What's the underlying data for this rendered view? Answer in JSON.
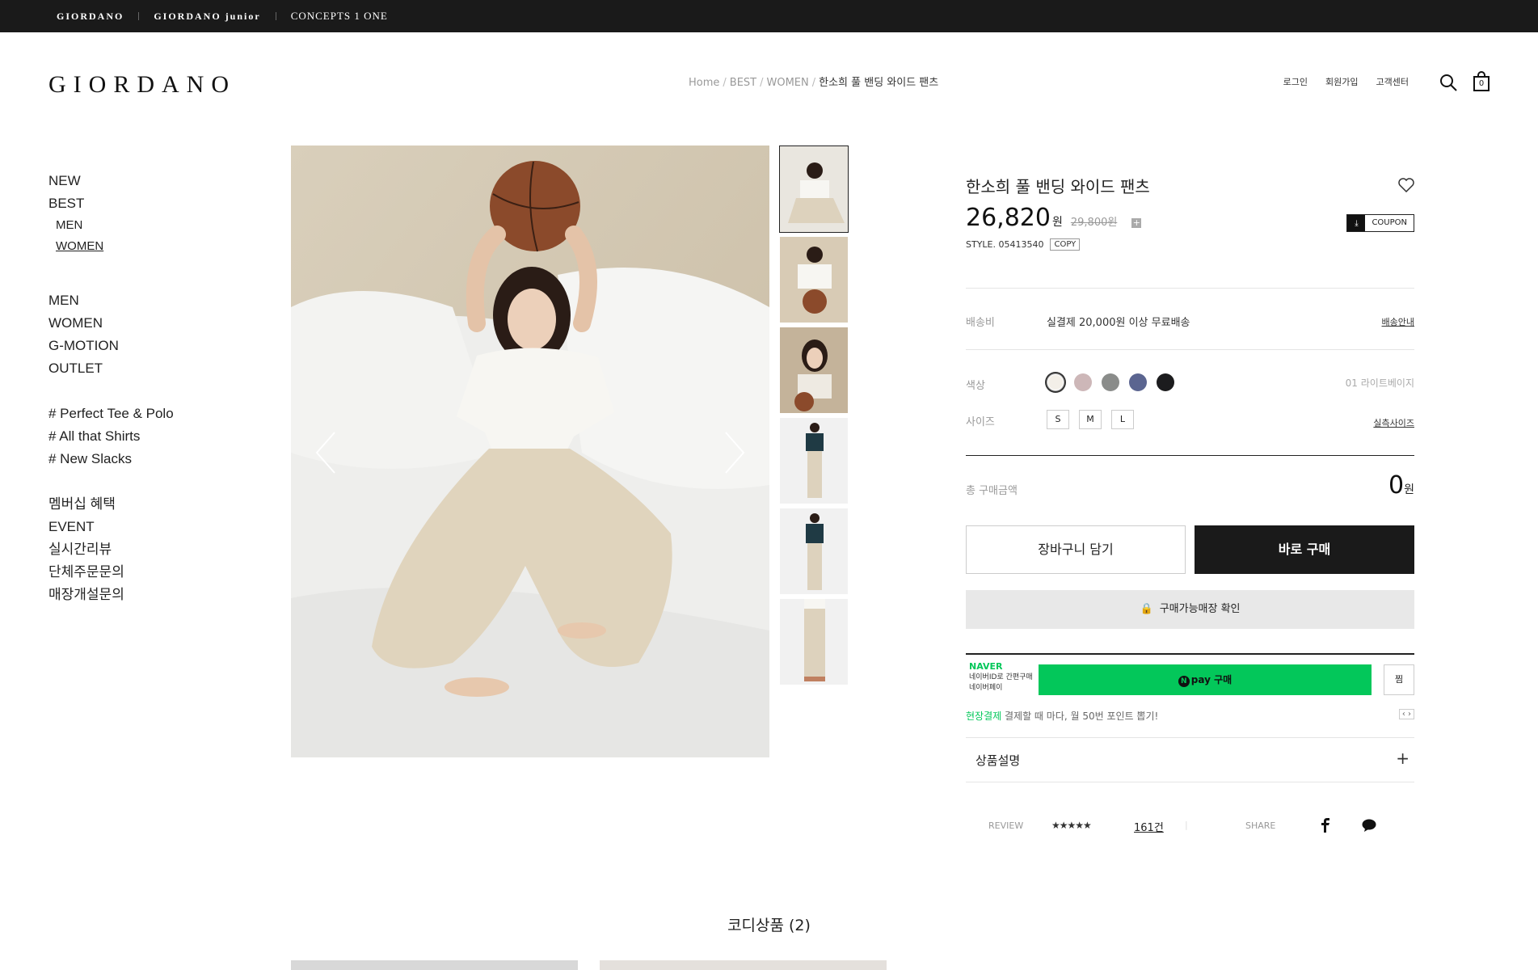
{
  "brandbar": {
    "brands": [
      "GIORDANO",
      "GIORDANO junior",
      "CONCEPTS 1 ONE"
    ]
  },
  "header": {
    "logo": "GIORDANO",
    "breadcrumb": [
      "Home",
      "BEST",
      "WOMEN",
      "한소희 풀 밴딩 와이드 팬츠"
    ],
    "util_links": [
      "로그인",
      "회원가입",
      "고객센터"
    ],
    "cart_count": "0"
  },
  "leftnav": {
    "group1": [
      "NEW",
      "BEST"
    ],
    "best_sub": [
      "MEN",
      "WOMEN"
    ],
    "group2": [
      "MEN",
      "WOMEN",
      "G-MOTION",
      "OUTLET"
    ],
    "hashtags": [
      "# Perfect Tee & Polo",
      "# All that Shirts",
      "# New Slacks"
    ],
    "group3": [
      "멤버십 혜택",
      "EVENT",
      "실시간리뷰",
      "단체주문문의",
      "매장개설문의"
    ]
  },
  "product": {
    "title": "한소희 풀 밴딩 와이드 팬츠",
    "price": "26,820",
    "price_unit": "원",
    "original_price": "29,800원",
    "coupon_label": "COUPON",
    "style_label": "STYLE. 05413540",
    "copy_label": "COPY",
    "shipping_label": "배송비",
    "shipping_value": "실결제 20,000원 이상 무료배송",
    "shipping_link": "배송안내",
    "color_label": "색상",
    "color_selected": "01 라이트베이지",
    "colors": [
      "#f3efe8",
      "#cdb7b8",
      "#8a8c8a",
      "#5b6590",
      "#1c1c1e"
    ],
    "size_label": "사이즈",
    "sizes": [
      "S",
      "M",
      "L"
    ],
    "size_link": "실측사이즈",
    "total_label": "총 구매금액",
    "total_value": "0",
    "total_unit": "원",
    "cart_button": "장바구니 담기",
    "buy_button": "바로 구매",
    "store_button": "구매가능매장 확인",
    "desc_label": "상품설명"
  },
  "npay": {
    "logo": "NAVER",
    "text_line1": "네이버ID로 간편구매",
    "text_line2": "네이버페이",
    "button": "pay 구매",
    "zzim": "찜",
    "promo_green": "현장결제",
    "promo_text": "결제할 때 마다, 월 50번 포인트 뽑기!"
  },
  "review": {
    "label": "REVIEW",
    "stars": "★★★★★",
    "count": "161건",
    "share_label": "SHARE"
  },
  "codi": {
    "title": "코디상품 (2)"
  }
}
